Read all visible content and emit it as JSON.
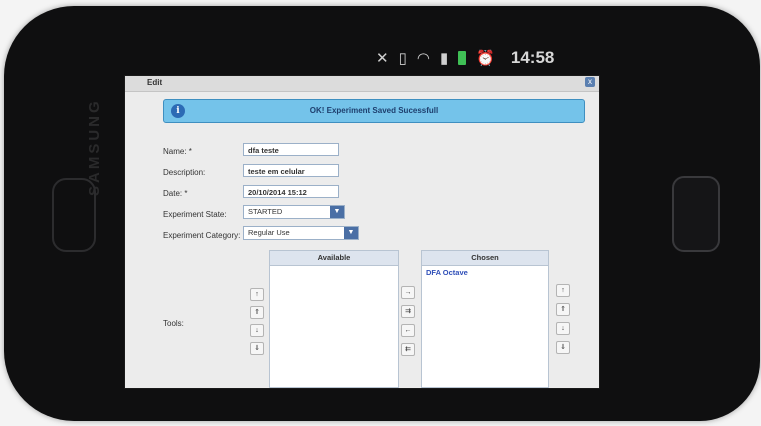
{
  "device": {
    "brand": "SAMSUNG"
  },
  "status_bar": {
    "icons": [
      "mute-icon",
      "vibrate-icon",
      "wifi-icon",
      "signal-icon",
      "battery-icon",
      "alarm-icon"
    ],
    "time": "14:58"
  },
  "dialog": {
    "title": "Edit",
    "close_label": "x"
  },
  "notice": {
    "icon": "i",
    "text": "OK! Experiment Saved Sucessfull"
  },
  "form": {
    "name_label": "Name: *",
    "name_value": "dfa teste",
    "description_label": "Description:",
    "description_value": "teste em celular",
    "date_label": "Date: *",
    "date_value": "20/10/2014 15:12",
    "state_label": "Experiment State:",
    "state_value": "STARTED",
    "category_label": "Experiment Category:",
    "category_value": "Regular Use",
    "tools_label": "Tools:"
  },
  "picklist": {
    "available_header": "Available",
    "chosen_header": "Chosen",
    "chosen_items": [
      "DFA Octave"
    ],
    "move_buttons": [
      "→",
      "⇉",
      "←",
      "⇇"
    ],
    "left_order_buttons": [
      "↑",
      "⇑",
      "↓",
      "⇓"
    ],
    "right_order_buttons": [
      "↑",
      "⇑",
      "↓",
      "⇓"
    ]
  },
  "colors": {
    "notice_bg": "#74c3ea",
    "chosen_text": "#2f4fb8",
    "select_arrow": "#4a6fa5"
  }
}
